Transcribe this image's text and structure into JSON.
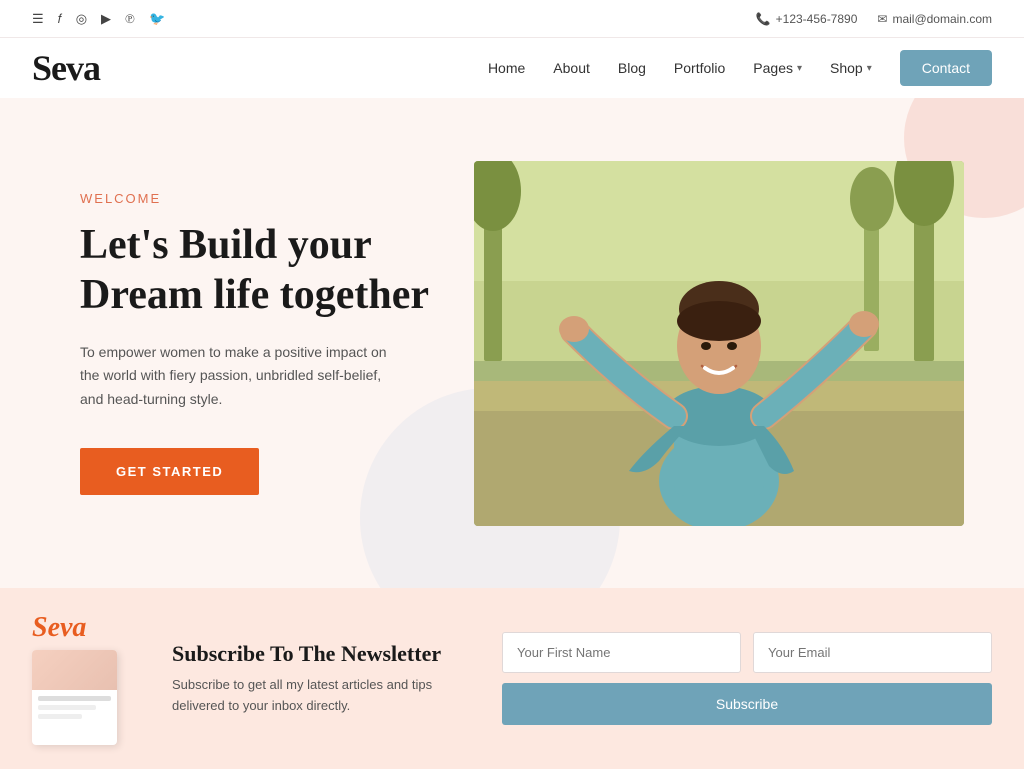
{
  "topbar": {
    "phone": "+123-456-7890",
    "email": "mail@domain.com"
  },
  "logo": {
    "text": "Seva"
  },
  "nav": {
    "items": [
      {
        "label": "Home"
      },
      {
        "label": "About"
      },
      {
        "label": "Blog"
      },
      {
        "label": "Portfolio"
      },
      {
        "label": "Pages",
        "hasDropdown": true
      },
      {
        "label": "Shop",
        "hasDropdown": true
      }
    ],
    "contact_label": "Contact"
  },
  "hero": {
    "welcome_label": "Welcome",
    "title_line1": "Let's Build your",
    "title_line2": "Dream life together",
    "description": "To empower women to make a positive impact on the world with fiery passion, unbridled self-belief, and head-turning style.",
    "cta_label": "GET STARTED"
  },
  "newsletter": {
    "logo": "Seva",
    "title": "Subscribe To The Newsletter",
    "subtitle": "Subscribe to get all my latest articles and tips delivered to your inbox directly.",
    "first_name_placeholder": "Your First Name",
    "email_placeholder": "Your Email",
    "subscribe_label": "Subscribe"
  }
}
